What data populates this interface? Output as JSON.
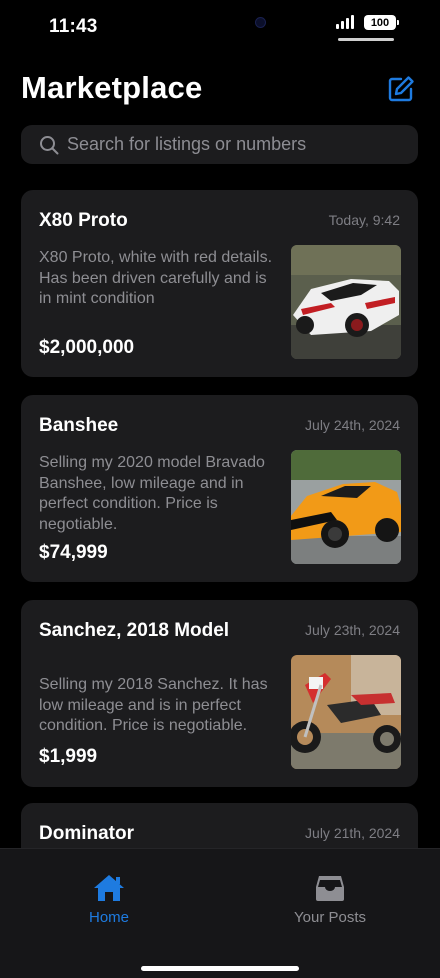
{
  "status": {
    "time": "11:43",
    "battery": "100"
  },
  "header": {
    "title": "Marketplace",
    "compose_icon": "compose-icon"
  },
  "search": {
    "placeholder": "Search for listings or numbers",
    "value": ""
  },
  "listings": [
    {
      "title": "X80 Proto",
      "date": "Today, 9:42",
      "description": "X80 Proto, white with red details. Has been driven carefully and is in mint condition",
      "price": "$2,000,000"
    },
    {
      "title": "Banshee",
      "date": "July 24th, 2024",
      "description": "Selling my 2020 model Bravado Banshee, low mileage and in perfect condition. Price is negotiable.",
      "price": "$74,999"
    },
    {
      "title": "Sanchez, 2018 Model",
      "date": "July 23th, 2024",
      "description": "Selling my 2018 Sanchez. It has low mileage and is in perfect condition. Price is negotiable.",
      "price": "$1,999"
    },
    {
      "title": "Dominator",
      "date": "July 21th, 2024",
      "description": "",
      "price": ""
    }
  ],
  "tabs": [
    {
      "label": "Home",
      "icon": "home-icon",
      "active": true,
      "color": "#1e7be0"
    },
    {
      "label": "Your Posts",
      "icon": "inbox-icon",
      "active": false,
      "color": "#8e8e93"
    }
  ]
}
